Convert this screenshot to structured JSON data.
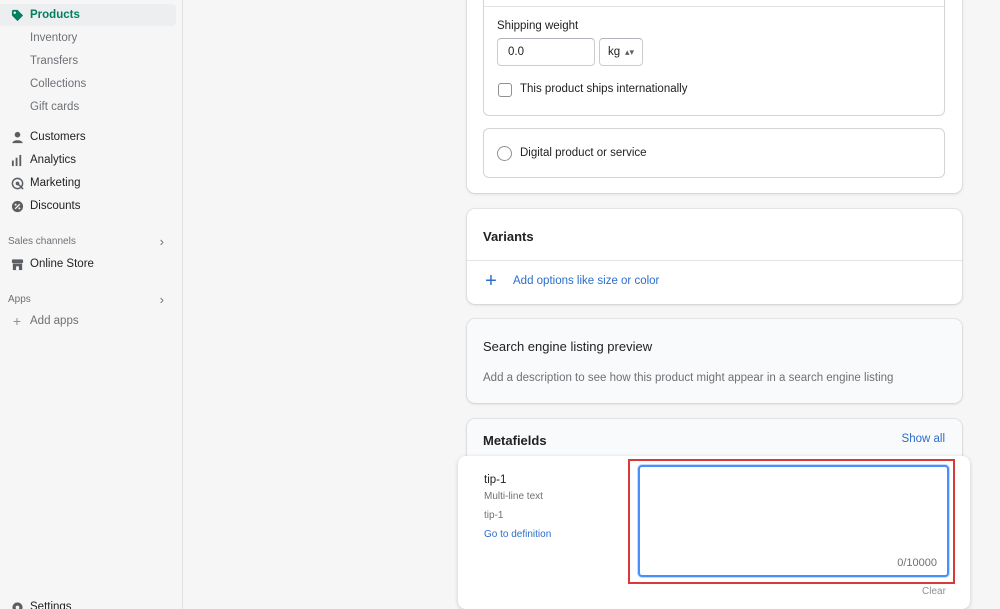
{
  "sidebar": {
    "products": "Products",
    "inventory": "Inventory",
    "transfers": "Transfers",
    "collections": "Collections",
    "gift_cards": "Gift cards",
    "customers": "Customers",
    "analytics": "Analytics",
    "marketing": "Marketing",
    "discounts": "Discounts",
    "sales_channels": "Sales channels",
    "online_store": "Online Store",
    "apps": "Apps",
    "add_apps": "Add apps",
    "settings": "Settings"
  },
  "shipping": {
    "weight_label": "Shipping weight",
    "weight_value": "0.0",
    "unit": "kg",
    "intl_label": "This product ships internationally",
    "digital_label": "Digital product or service"
  },
  "variants": {
    "title": "Variants",
    "add_options": "Add options like size or color"
  },
  "seo": {
    "title": "Search engine listing preview",
    "description": "Add a description to see how this product might appear in a search engine listing"
  },
  "metafields": {
    "title": "Metafields",
    "show_all": "Show all",
    "field": {
      "name": "tip-1",
      "type": "Multi-line text",
      "key": "tip-1",
      "link": "Go to definition",
      "value": "",
      "counter": "0/10000",
      "clear": "Clear"
    }
  },
  "colors": {
    "accent": "#008060",
    "link": "#2c6ecb",
    "focus": "#458fff",
    "highlight": "#d83a3a"
  }
}
